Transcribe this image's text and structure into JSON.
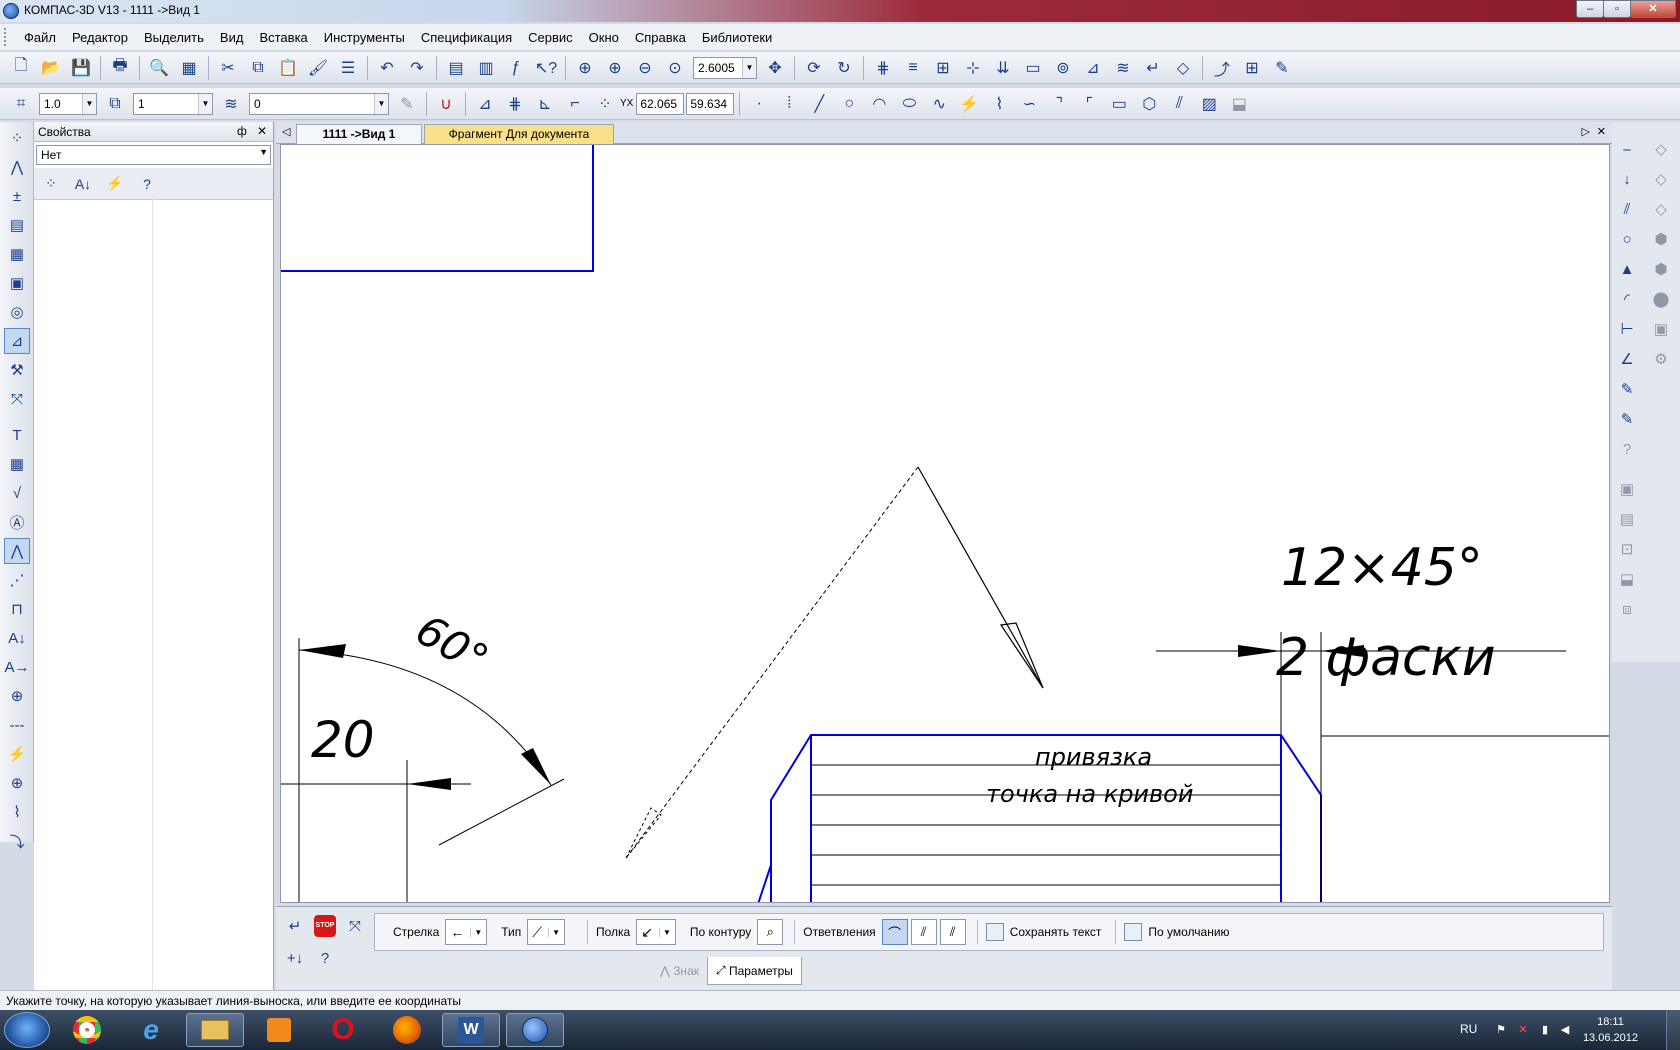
{
  "window": {
    "title": "КОМПАС-3D V13 - 1111 ->Вид 1",
    "min_glyph": "‒",
    "max_glyph": "▫",
    "close_glyph": "✕"
  },
  "menu": [
    "Файл",
    "Редактор",
    "Выделить",
    "Вид",
    "Вставка",
    "Инструменты",
    "Спецификация",
    "Сервис",
    "Окно",
    "Справка",
    "Библиотеки"
  ],
  "toolbar1": {
    "zoom_value": "2.6005"
  },
  "toolbar2": {
    "line_scale": "1.0",
    "layer_state": "1",
    "layer": "0",
    "coord_x": "62.065",
    "coord_y": "59.634",
    "coord_xy_label": "Y",
    "coord_x_label": "X"
  },
  "properties": {
    "title": "Свойства",
    "pin_glyph": "ф",
    "close_glyph": "✕",
    "filter_value": "Нет"
  },
  "tabs": {
    "view_tab": "1111 ->Вид 1",
    "fragment_tab": "Фрагмент Для документа"
  },
  "drawing": {
    "angle_label": "60°",
    "dim_label": "20",
    "chamfer_label": "12×45°",
    "chamfer_note": "2 фаски",
    "snap_line1": "привязка",
    "snap_line2": "точка на кривой"
  },
  "propbar": {
    "arrow_label": "Стрелка",
    "type_label": "Тип",
    "shelf_label": "Полка",
    "contour_label": "По контуру",
    "branches_label": "Ответвления",
    "keep_text_label": "Сохранять текст",
    "default_label": "По умолчанию",
    "tab_sign": "Знак",
    "tab_params": "Параметры",
    "stop_label": "STOP",
    "help_glyph": "?"
  },
  "status": {
    "message": "Укажите точку, на которую указывает линия-выноска, или введите ее координаты"
  },
  "taskbar": {
    "lang": "RU",
    "time": "18:11",
    "date": "13.06.2012",
    "apps": [
      "chrome-icon",
      "ie-icon",
      "explorer-icon",
      "media-player-icon",
      "opera-icon",
      "firefox-icon",
      "word-icon",
      "kompas-icon"
    ],
    "word_glyph": "W",
    "opera_glyph": "O",
    "ie_glyph": "e"
  },
  "colors": {
    "accent": "#1a3e8a",
    "drawing_blue": "#0000e0",
    "fragment_tab": "#fbe08a"
  }
}
